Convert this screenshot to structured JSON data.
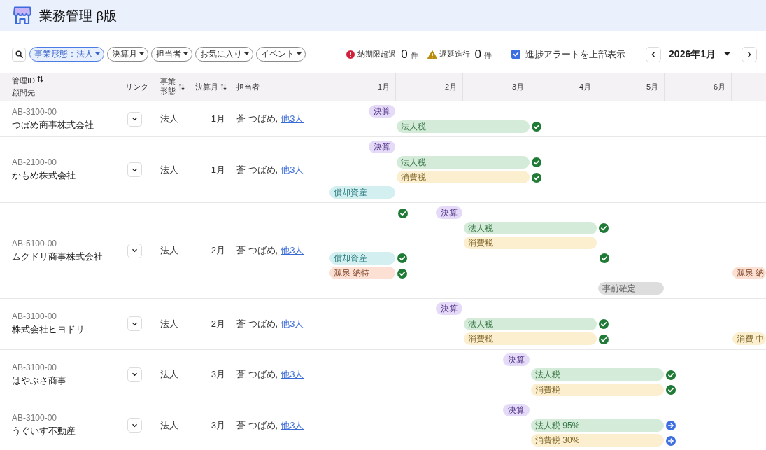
{
  "app": {
    "title": "業務管理 β版"
  },
  "toolbar": {
    "filters": [
      {
        "label": "事業形態：法人",
        "selected": true
      },
      {
        "label": "決算月",
        "selected": false
      },
      {
        "label": "担当者",
        "selected": false
      },
      {
        "label": "お気に入り",
        "selected": false
      },
      {
        "label": "イベント",
        "selected": false
      }
    ],
    "alerts": [
      {
        "kind": "overdue",
        "label": "納期限超過",
        "count": "0",
        "unit": "件"
      },
      {
        "kind": "delayed",
        "label": "遅延進行",
        "count": "0",
        "unit": "件"
      }
    ],
    "alert_toggle": {
      "label": "進捗アラートを上部表示",
      "checked": true
    },
    "period": {
      "label": "2026年1月"
    }
  },
  "table": {
    "columns": [
      {
        "label": "管理ID",
        "sublabel": "顧問先",
        "sortable": true
      },
      {
        "label": "リンク",
        "sortable": false
      },
      {
        "label": "事業形態",
        "sortable": true
      },
      {
        "label": "決算月",
        "sortable": true
      },
      {
        "label": "担当者",
        "sortable": false
      }
    ],
    "months": [
      "1月",
      "2月",
      "3月",
      "4月",
      "5月",
      "6月"
    ],
    "rows": [
      {
        "id": "AB-3100-00",
        "client": "つばめ商事株式会社",
        "business_type": "法人",
        "fiscal_month": "1月",
        "staff": "蒼 つばめ,",
        "staff_more": "他3人",
        "lanes": [
          [
            {
              "kind": "milestone",
              "label": "決算",
              "color": "#e5dbf8"
            }
          ],
          [
            {
              "kind": "blank"
            },
            {
              "kind": "bar",
              "label": "法人税",
              "color": "#d3ebd8",
              "completed": true,
              "in_progress": false
            },
            {
              "kind": "span"
            }
          ]
        ]
      },
      {
        "id": "AB-2100-00",
        "client": "かもめ株式会社",
        "business_type": "法人",
        "fiscal_month": "1月",
        "staff": "蒼 つばめ,",
        "staff_more": "他3人",
        "lanes": [
          [
            {
              "kind": "milestone",
              "label": "決算",
              "color": "#e5dbf8"
            }
          ],
          [
            {
              "kind": "blank"
            },
            {
              "kind": "bar",
              "label": "法人税",
              "color": "#d3ebd8",
              "completed": true,
              "in_progress": false
            },
            {
              "kind": "span"
            }
          ],
          [
            {
              "kind": "blank"
            },
            {
              "kind": "bar",
              "label": "消費税",
              "color": "#fcefd0",
              "completed": true,
              "in_progress": false
            },
            {
              "kind": "span"
            }
          ],
          [
            {
              "kind": "bar",
              "label": "償却資産",
              "color": "#d3eff0",
              "completed": false,
              "in_progress": false
            }
          ]
        ]
      },
      {
        "id": "AB-5100-00",
        "client": "ムクドリ商事株式会社",
        "business_type": "法人",
        "fiscal_month": "2月",
        "staff": "蒼 つばめ,",
        "staff_more": "他3人",
        "lanes": [
          [
            {
              "kind": "mark",
              "completed": true,
              "in_progress": false
            },
            {
              "kind": "milestone",
              "label": "決算",
              "color": "#e5dbf8"
            }
          ],
          [
            {
              "kind": "blank"
            },
            {
              "kind": "blank"
            },
            {
              "kind": "bar",
              "label": "法人税",
              "color": "#d3ebd8",
              "completed": true,
              "in_progress": false
            },
            {
              "kind": "span"
            }
          ],
          [
            {
              "kind": "blank"
            },
            {
              "kind": "blank"
            },
            {
              "kind": "bar",
              "label": "消費税",
              "color": "#fcefd0",
              "completed": false,
              "in_progress": false
            },
            {
              "kind": "span"
            }
          ],
          [
            {
              "kind": "bar",
              "label": "償却資産",
              "color": "#d3eff0",
              "completed": true,
              "in_progress": false
            },
            {
              "kind": "blank"
            },
            {
              "kind": "blank"
            },
            {
              "kind": "mark",
              "completed": true,
              "in_progress": false
            }
          ],
          [
            {
              "kind": "bar",
              "label": "源泉 納特",
              "color": "#fbe0d3",
              "completed": true,
              "in_progress": false
            },
            {
              "kind": "blank"
            },
            {
              "kind": "blank"
            },
            {
              "kind": "blank"
            },
            {
              "kind": "blank"
            },
            {
              "kind": "blank"
            },
            {
              "kind": "bar",
              "label": "源泉 納",
              "color": "#fbe0d3"
            }
          ],
          [
            {
              "kind": "blank"
            },
            {
              "kind": "blank"
            },
            {
              "kind": "blank"
            },
            {
              "kind": "blank"
            },
            {
              "kind": "bar",
              "label": "事前確定",
              "color": "#dddddd",
              "completed": false,
              "in_progress": false
            }
          ]
        ]
      },
      {
        "id": "AB-3100-00",
        "client": "株式会社ヒヨドリ",
        "business_type": "法人",
        "fiscal_month": "2月",
        "staff": "蒼 つばめ,",
        "staff_more": "他3人",
        "lanes": [
          [
            {
              "kind": "blank"
            },
            {
              "kind": "milestone",
              "label": "決算",
              "color": "#e5dbf8"
            }
          ],
          [
            {
              "kind": "blank"
            },
            {
              "kind": "blank"
            },
            {
              "kind": "bar",
              "label": "法人税",
              "color": "#d3ebd8",
              "completed": true,
              "in_progress": false
            },
            {
              "kind": "span"
            }
          ],
          [
            {
              "kind": "blank"
            },
            {
              "kind": "blank"
            },
            {
              "kind": "bar",
              "label": "消費税",
              "color": "#fcefd0",
              "completed": true,
              "in_progress": false
            },
            {
              "kind": "span"
            },
            {
              "kind": "blank"
            },
            {
              "kind": "blank"
            },
            {
              "kind": "bar",
              "label": "消費 中",
              "color": "#fcefd0"
            }
          ]
        ]
      },
      {
        "id": "AB-3100-00",
        "client": "はやぶさ商事",
        "business_type": "法人",
        "fiscal_month": "3月",
        "staff": "蒼 つばめ,",
        "staff_more": "他3人",
        "lanes": [
          [
            {
              "kind": "blank"
            },
            {
              "kind": "blank"
            },
            {
              "kind": "milestone",
              "label": "決算",
              "color": "#e5dbf8"
            }
          ],
          [
            {
              "kind": "blank"
            },
            {
              "kind": "blank"
            },
            {
              "kind": "blank"
            },
            {
              "kind": "bar",
              "label": "法人税",
              "color": "#d3ebd8",
              "completed": true,
              "in_progress": false
            },
            {
              "kind": "span"
            }
          ],
          [
            {
              "kind": "blank"
            },
            {
              "kind": "blank"
            },
            {
              "kind": "blank"
            },
            {
              "kind": "bar",
              "label": "消費税",
              "color": "#fcefd0",
              "completed": true,
              "in_progress": false
            },
            {
              "kind": "span"
            }
          ]
        ]
      },
      {
        "id": "AB-3100-00",
        "client": "うぐいす不動産",
        "business_type": "法人",
        "fiscal_month": "3月",
        "staff": "蒼 つばめ,",
        "staff_more": "他3人",
        "lanes": [
          [
            {
              "kind": "blank"
            },
            {
              "kind": "blank"
            },
            {
              "kind": "milestone",
              "label": "決算",
              "color": "#e5dbf8"
            }
          ],
          [
            {
              "kind": "blank"
            },
            {
              "kind": "blank"
            },
            {
              "kind": "blank"
            },
            {
              "kind": "bar",
              "label": "法人税 95%",
              "color": "#d3ebd8",
              "completed": false,
              "in_progress": true
            },
            {
              "kind": "span"
            }
          ],
          [
            {
              "kind": "blank"
            },
            {
              "kind": "blank"
            },
            {
              "kind": "blank"
            },
            {
              "kind": "bar",
              "label": "消費税 30%",
              "color": "#fcefd0",
              "completed": false,
              "in_progress": true
            },
            {
              "kind": "span"
            }
          ]
        ]
      }
    ]
  }
}
